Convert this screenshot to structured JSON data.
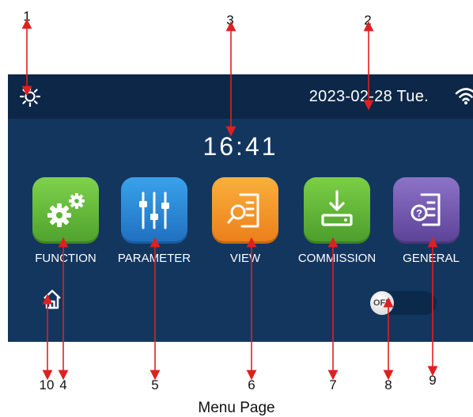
{
  "callouts": [
    "1",
    "2",
    "3",
    "4",
    "5",
    "6",
    "7",
    "8",
    "9",
    "10"
  ],
  "status_bar": {
    "icon": "sun-icon",
    "date": "2023-02-28 Tue.",
    "signal_icon": "wifi-icon"
  },
  "clock": "16:41",
  "menu": [
    {
      "label": "FUNCTION",
      "icon": "gears-icon",
      "color": "#5db536"
    },
    {
      "label": "PARAMETER",
      "icon": "sliders-icon",
      "color": "#2a86d8"
    },
    {
      "label": "VIEW",
      "icon": "document-search-icon",
      "color": "#f29a2e"
    },
    {
      "label": "COMMISSION",
      "icon": "download-icon",
      "color": "#5db536"
    },
    {
      "label": "GENERAL",
      "icon": "document-help-icon",
      "color": "#7257b0"
    }
  ],
  "home_icon": "home-icon",
  "power_toggle": {
    "label": "OFF",
    "state": "off"
  },
  "caption": "Menu Page",
  "colors": {
    "screen": "#13365f",
    "status_bar": "#0c2747",
    "callout": "#e02020"
  }
}
